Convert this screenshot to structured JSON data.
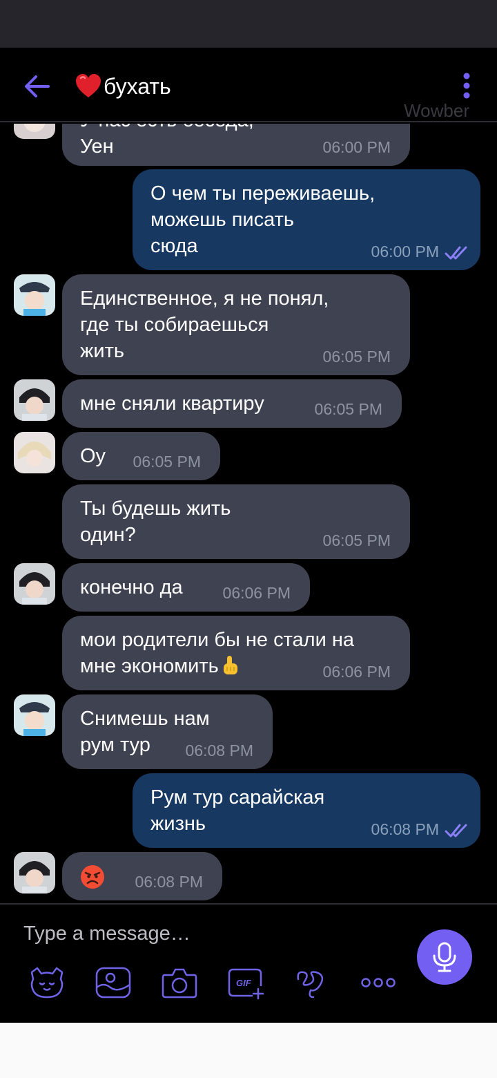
{
  "header": {
    "title": "бухать",
    "watermark": "Wowber"
  },
  "icons": {
    "back": "arrow-left-icon",
    "heart": "heart-icon",
    "menu": "more-vertical-icon",
    "read": "double-check-icon",
    "mic": "microphone-icon",
    "sticker": "sticker-icon",
    "gallery": "gallery-icon",
    "camera": "camera-icon",
    "gif": "gif-icon",
    "doodle": "doodle-icon",
    "more": "more-horizontal-icon"
  },
  "colors": {
    "accent": "#7360f2",
    "incoming_bubble": "#3f4251",
    "outgoing_bubble": "#173861",
    "time": "#8e93a3"
  },
  "messages": [
    {
      "dir": "in",
      "text_partial": "У нас есть беседа,",
      "text": "Уен",
      "time": "06:00 PM"
    },
    {
      "dir": "out",
      "lines": [
        "О чем ты переживаешь,",
        "можешь писать",
        "сюда"
      ],
      "time": "06:00 PM"
    },
    {
      "dir": "in",
      "lines": [
        "Единственное, я не понял,",
        "где ты собираешься",
        "жить"
      ],
      "time": "06:05 PM"
    },
    {
      "dir": "in",
      "text": "мне сняли квартиру",
      "time": "06:05 PM"
    },
    {
      "dir": "in",
      "text": "Оу",
      "time": "06:05 PM"
    },
    {
      "dir": "in",
      "lines": [
        "Ты будешь жить",
        "один?"
      ],
      "time": "06:05 PM"
    },
    {
      "dir": "in",
      "text": "конечно да",
      "time": "06:06 PM"
    },
    {
      "dir": "in",
      "lines": [
        "мои родители бы не стали на",
        "мне экономить"
      ],
      "emoji": "☝",
      "time": "06:06 PM"
    },
    {
      "dir": "in",
      "lines": [
        "Снимешь нам",
        "рум тур"
      ],
      "time": "06:08 PM"
    },
    {
      "dir": "out",
      "lines": [
        "Рум тур сарайская",
        "жизнь"
      ],
      "time": "06:08 PM"
    },
    {
      "dir": "in",
      "emoji": "angry-face",
      "time": "06:08 PM"
    }
  ],
  "composer": {
    "placeholder": "Type a message…"
  }
}
